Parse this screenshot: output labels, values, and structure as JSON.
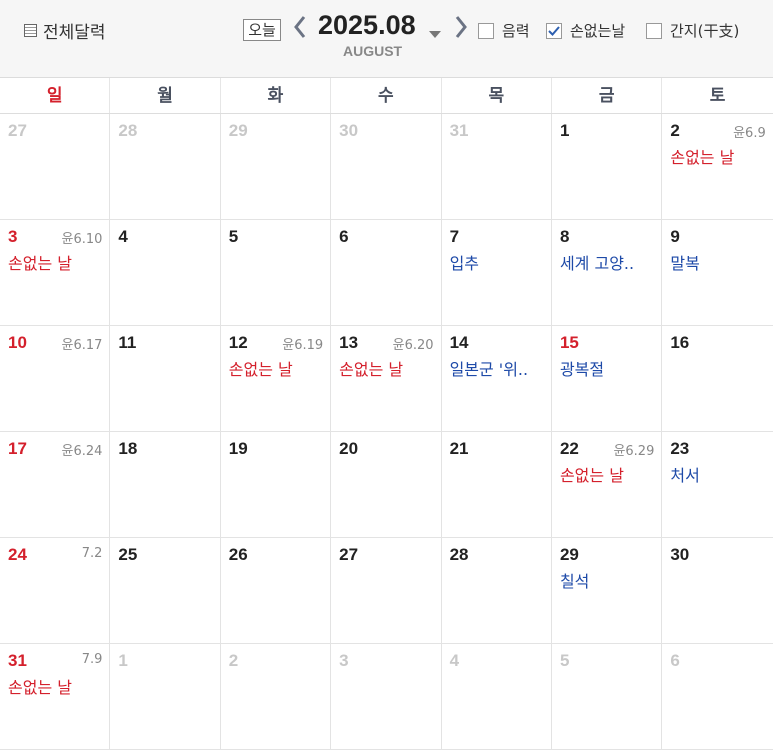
{
  "header": {
    "full_calendar_label": "전체달력",
    "today_label": "오늘",
    "month_title": "2025.08",
    "month_sub": "AUGUST",
    "options": [
      {
        "label": "음력",
        "checked": false
      },
      {
        "label": "손없는날",
        "checked": true
      },
      {
        "label": "간지(干支)",
        "checked": false
      }
    ]
  },
  "weekdays": [
    "일",
    "월",
    "화",
    "수",
    "목",
    "금",
    "토"
  ],
  "weeks": [
    [
      {
        "num": "27",
        "other": true
      },
      {
        "num": "28",
        "other": true
      },
      {
        "num": "29",
        "other": true
      },
      {
        "num": "30",
        "other": true
      },
      {
        "num": "31",
        "other": true
      },
      {
        "num": "1"
      },
      {
        "num": "2",
        "lunar": "윤6.9",
        "event": "손없는 날",
        "event_color": "red"
      }
    ],
    [
      {
        "num": "3",
        "sun": true,
        "lunar": "윤6.10",
        "event": "손없는 날",
        "event_color": "red"
      },
      {
        "num": "4"
      },
      {
        "num": "5"
      },
      {
        "num": "6"
      },
      {
        "num": "7",
        "event": "입추",
        "event_color": "blue"
      },
      {
        "num": "8",
        "event": "세계 고양..",
        "event_color": "blue"
      },
      {
        "num": "9",
        "event": "말복",
        "event_color": "blue"
      }
    ],
    [
      {
        "num": "10",
        "sun": true,
        "lunar": "윤6.17"
      },
      {
        "num": "11"
      },
      {
        "num": "12",
        "lunar": "윤6.19",
        "event": "손없는 날",
        "event_color": "red"
      },
      {
        "num": "13",
        "lunar": "윤6.20",
        "event": "손없는 날",
        "event_color": "red"
      },
      {
        "num": "14",
        "event": "일본군 '위..",
        "event_color": "blue"
      },
      {
        "num": "15",
        "sun": true,
        "event": "광복절",
        "event_color": "blue"
      },
      {
        "num": "16"
      }
    ],
    [
      {
        "num": "17",
        "sun": true,
        "lunar": "윤6.24"
      },
      {
        "num": "18"
      },
      {
        "num": "19"
      },
      {
        "num": "20"
      },
      {
        "num": "21"
      },
      {
        "num": "22",
        "lunar": "윤6.29",
        "event": "손없는 날",
        "event_color": "red"
      },
      {
        "num": "23",
        "event": "처서",
        "event_color": "blue"
      }
    ],
    [
      {
        "num": "24",
        "sun": true,
        "lunar": "7.2"
      },
      {
        "num": "25"
      },
      {
        "num": "26"
      },
      {
        "num": "27"
      },
      {
        "num": "28"
      },
      {
        "num": "29",
        "event": "칠석",
        "event_color": "blue"
      },
      {
        "num": "30"
      }
    ],
    [
      {
        "num": "31",
        "sun": true,
        "lunar": "7.9",
        "event": "손없는 날",
        "event_color": "red"
      },
      {
        "num": "1",
        "other": true
      },
      {
        "num": "2",
        "other": true
      },
      {
        "num": "3",
        "other": true
      },
      {
        "num": "4",
        "other": true
      },
      {
        "num": "5",
        "other": true
      },
      {
        "num": "6",
        "other": true
      }
    ]
  ],
  "colors": {
    "holiday_red": "#d4202c",
    "event_blue": "#1e4aa8",
    "header_bg": "#f6f6f6"
  }
}
